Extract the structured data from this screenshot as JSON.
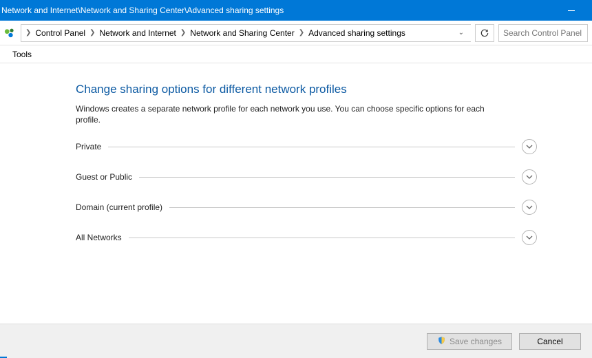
{
  "window": {
    "title_path": "Network and Internet\\Network and Sharing Center\\Advanced sharing settings"
  },
  "breadcrumb": {
    "items": [
      "Control Panel",
      "Network and Internet",
      "Network and Sharing Center",
      "Advanced sharing settings"
    ]
  },
  "search": {
    "placeholder": "Search Control Panel"
  },
  "menu": {
    "tools": "Tools"
  },
  "page": {
    "title": "Change sharing options for different network profiles",
    "description": "Windows creates a separate network profile for each network you use. You can choose specific options for each profile."
  },
  "sections": [
    {
      "label": "Private"
    },
    {
      "label": "Guest or Public"
    },
    {
      "label": "Domain (current profile)"
    },
    {
      "label": "All Networks"
    }
  ],
  "footer": {
    "save": "Save changes",
    "cancel": "Cancel"
  },
  "colors": {
    "accent": "#0078d7",
    "heading": "#0b59a2"
  }
}
